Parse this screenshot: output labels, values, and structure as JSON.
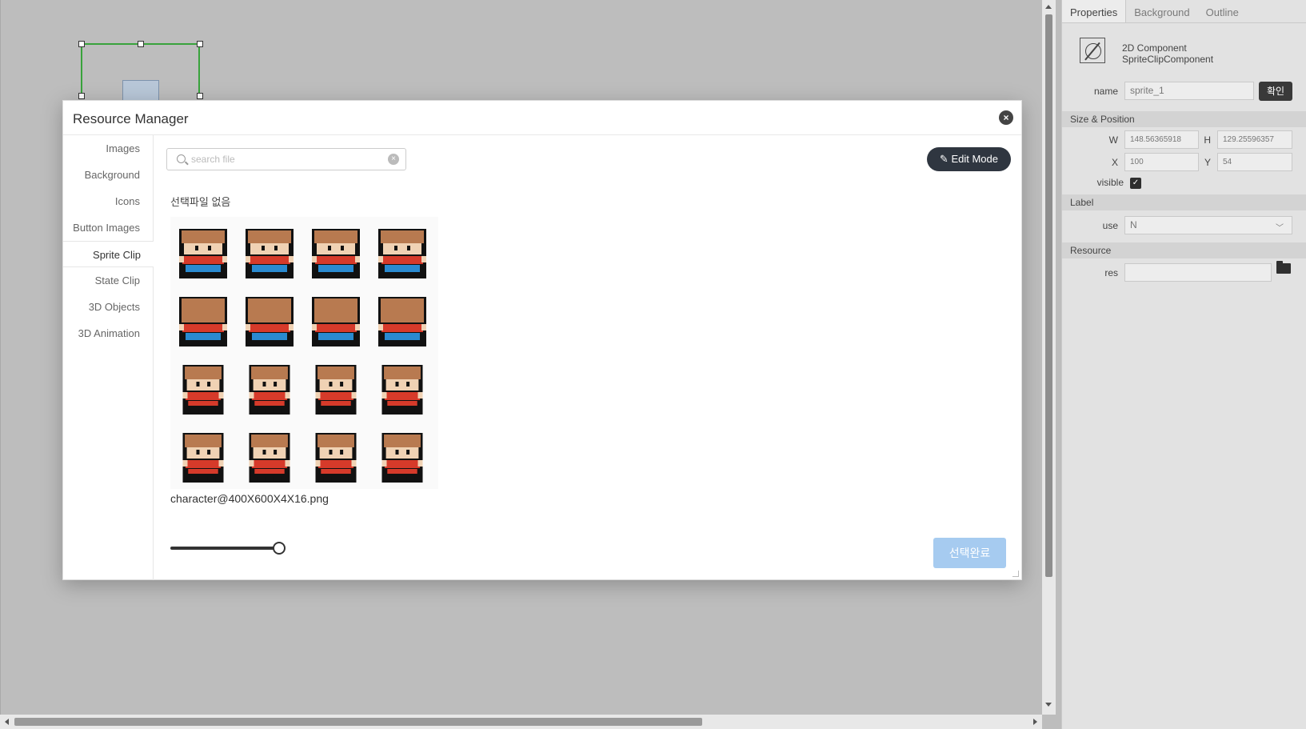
{
  "panel": {
    "tabs": [
      "Properties",
      "Background",
      "Outline"
    ],
    "component": {
      "line1": "2D Component",
      "line2": "SpriteClipComponent"
    },
    "name_label": "name",
    "name_value": "sprite_1",
    "confirm_label": "확인",
    "size_section": "Size & Position",
    "w_label": "W",
    "w_value": "148.56365918",
    "h_label": "H",
    "h_value": "129.25596357",
    "x_label": "X",
    "x_value": "100",
    "y_label": "Y",
    "y_value": "54",
    "visible_label": "visible",
    "visible_checked": true,
    "label_section": "Label",
    "use_label": "use",
    "use_value": "N",
    "resource_section": "Resource",
    "res_label": "res",
    "res_value": ""
  },
  "modal": {
    "title": "Resource Manager",
    "categories": [
      "Images",
      "Background",
      "Icons",
      "Button Images",
      "Sprite Clip",
      "State Clip",
      "3D Objects",
      "3D Animation"
    ],
    "active_category": "Sprite Clip",
    "search_placeholder": "search file",
    "edit_mode_label": "Edit Mode",
    "selection_status": "선택파일 없음",
    "file_name": "character@400X600X4X16.png",
    "zoom_slider": 1.0,
    "done_label": "선택완료"
  },
  "colors": {
    "skin": "#f0d2b4",
    "hair": "#b87a50",
    "shirt": "#d63a2a",
    "pants": "#2a8ad0",
    "outline": "#111111",
    "done_button": "#a6cbf0",
    "selection_border": "#39a33c"
  }
}
